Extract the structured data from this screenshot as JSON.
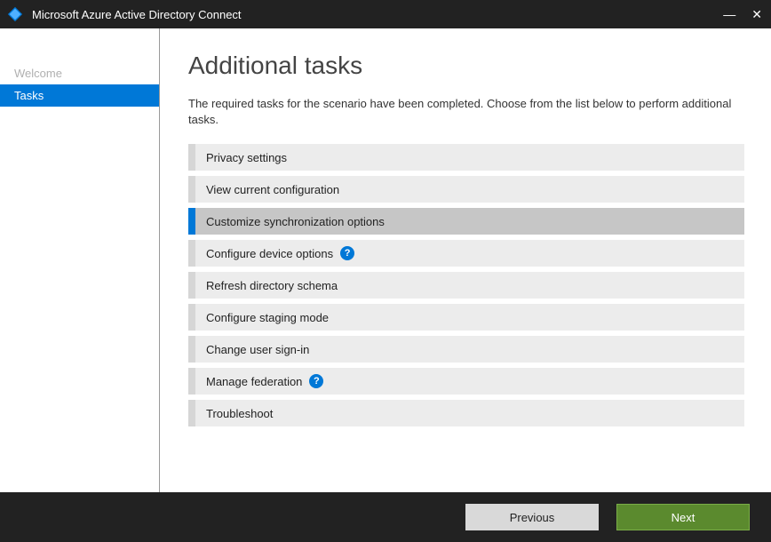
{
  "window": {
    "title": "Microsoft Azure Active Directory Connect"
  },
  "sidebar": {
    "items": [
      {
        "label": "Welcome",
        "state": "inactive"
      },
      {
        "label": "Tasks",
        "state": "active"
      }
    ]
  },
  "main": {
    "heading": "Additional tasks",
    "intro": "The required tasks for the scenario have been completed. Choose from the list below to perform additional tasks.",
    "tasks": [
      {
        "label": "Privacy settings",
        "selected": false,
        "help": false
      },
      {
        "label": "View current configuration",
        "selected": false,
        "help": false
      },
      {
        "label": "Customize synchronization options",
        "selected": true,
        "help": false
      },
      {
        "label": "Configure device options",
        "selected": false,
        "help": true
      },
      {
        "label": "Refresh directory schema",
        "selected": false,
        "help": false
      },
      {
        "label": "Configure staging mode",
        "selected": false,
        "help": false
      },
      {
        "label": "Change user sign-in",
        "selected": false,
        "help": false
      },
      {
        "label": "Manage federation",
        "selected": false,
        "help": true
      },
      {
        "label": "Troubleshoot",
        "selected": false,
        "help": false
      }
    ]
  },
  "footer": {
    "previous": "Previous",
    "next": "Next"
  },
  "icons": {
    "help_glyph": "?"
  }
}
